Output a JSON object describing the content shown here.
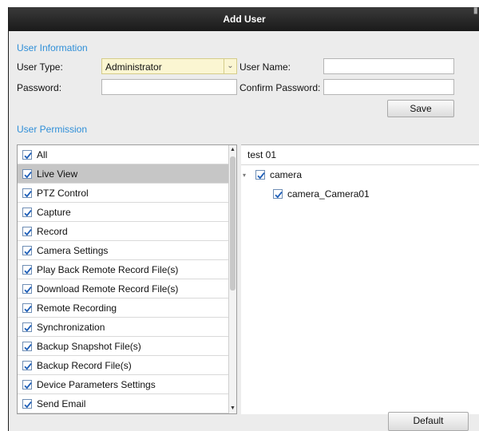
{
  "window": {
    "title": "Add User"
  },
  "user_info": {
    "section_label": "User Information",
    "user_type_label": "User Type:",
    "user_type_value": "Administrator",
    "user_name_label": "User Name:",
    "user_name_value": "",
    "password_label": "Password:",
    "password_value": "",
    "confirm_password_label": "Confirm Password:",
    "confirm_password_value": "",
    "save_label": "Save"
  },
  "permissions": {
    "section_label": "User Permission",
    "items": [
      {
        "label": "All",
        "checked": true,
        "selected": false
      },
      {
        "label": "Live View",
        "checked": true,
        "selected": true
      },
      {
        "label": "PTZ Control",
        "checked": true,
        "selected": false
      },
      {
        "label": "Capture",
        "checked": true,
        "selected": false
      },
      {
        "label": "Record",
        "checked": true,
        "selected": false
      },
      {
        "label": "Camera Settings",
        "checked": true,
        "selected": false
      },
      {
        "label": "Play Back Remote Record File(s)",
        "checked": true,
        "selected": false
      },
      {
        "label": "Download Remote Record File(s)",
        "checked": true,
        "selected": false
      },
      {
        "label": "Remote Recording",
        "checked": true,
        "selected": false
      },
      {
        "label": "Synchronization",
        "checked": true,
        "selected": false
      },
      {
        "label": "Backup Snapshot File(s)",
        "checked": true,
        "selected": false
      },
      {
        "label": "Backup Record File(s)",
        "checked": true,
        "selected": false
      },
      {
        "label": "Device Parameters Settings",
        "checked": true,
        "selected": false
      },
      {
        "label": "Send Email",
        "checked": true,
        "selected": false
      }
    ]
  },
  "device_tree": {
    "root": "test 01",
    "group": {
      "label": "camera",
      "checked": true,
      "expanded": true
    },
    "children": [
      {
        "label": "camera_Camera01",
        "checked": true
      }
    ]
  },
  "footer": {
    "default_label": "Default"
  },
  "colors": {
    "accent": "#2f8fd8",
    "selected_row": "#c6c6c6",
    "select_bg": "#fbf6d2"
  }
}
